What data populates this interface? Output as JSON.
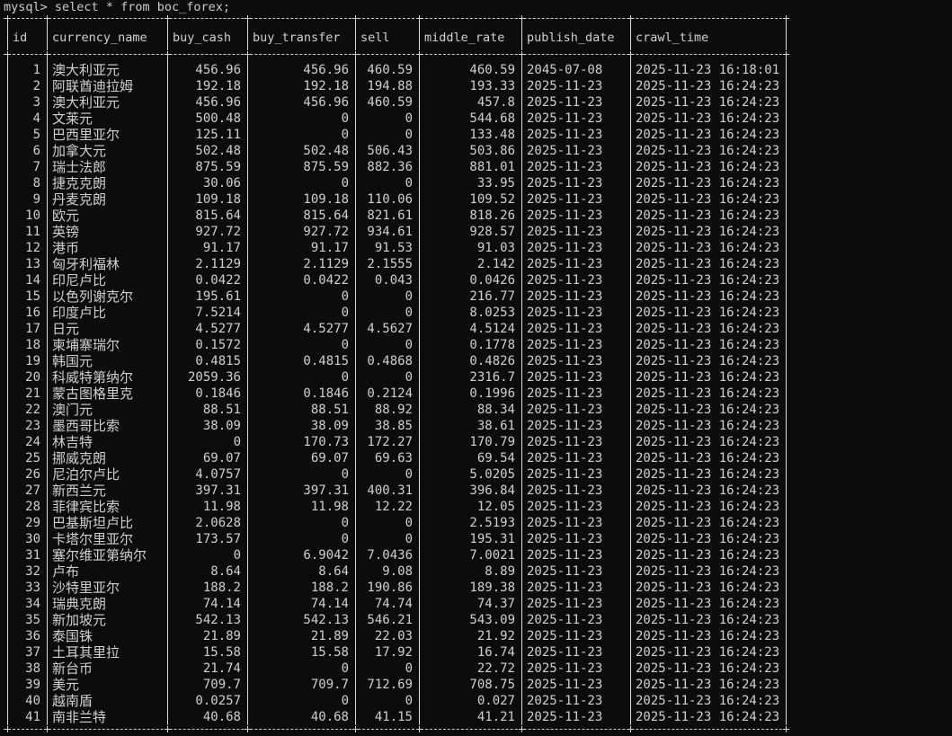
{
  "console": {
    "prompt": "mysql>",
    "command": "select * from boc_forex;"
  },
  "table": {
    "columns": [
      "id",
      "currency_name",
      "buy_cash",
      "buy_transfer",
      "sell",
      "middle_rate",
      "publish_date",
      "crawl_time"
    ],
    "rows": [
      [
        "1",
        "澳大利亚元",
        "456.96",
        "456.96",
        "460.59",
        "460.59",
        "2045-07-08",
        "2025-11-23 16:18:01"
      ],
      [
        "2",
        "阿联酋迪拉姆",
        "192.18",
        "192.18",
        "194.88",
        "193.33",
        "2025-11-23",
        "2025-11-23 16:24:23"
      ],
      [
        "3",
        "澳大利亚元",
        "456.96",
        "456.96",
        "460.59",
        "457.8",
        "2025-11-23",
        "2025-11-23 16:24:23"
      ],
      [
        "4",
        "文莱元",
        "500.48",
        "0",
        "0",
        "544.68",
        "2025-11-23",
        "2025-11-23 16:24:23"
      ],
      [
        "5",
        "巴西里亚尔",
        "125.11",
        "0",
        "0",
        "133.48",
        "2025-11-23",
        "2025-11-23 16:24:23"
      ],
      [
        "6",
        "加拿大元",
        "502.48",
        "502.48",
        "506.43",
        "503.86",
        "2025-11-23",
        "2025-11-23 16:24:23"
      ],
      [
        "7",
        "瑞士法郎",
        "875.59",
        "875.59",
        "882.36",
        "881.01",
        "2025-11-23",
        "2025-11-23 16:24:23"
      ],
      [
        "8",
        "捷克克朗",
        "30.06",
        "0",
        "0",
        "33.95",
        "2025-11-23",
        "2025-11-23 16:24:23"
      ],
      [
        "9",
        "丹麦克朗",
        "109.18",
        "109.18",
        "110.06",
        "109.52",
        "2025-11-23",
        "2025-11-23 16:24:23"
      ],
      [
        "10",
        "欧元",
        "815.64",
        "815.64",
        "821.61",
        "818.26",
        "2025-11-23",
        "2025-11-23 16:24:23"
      ],
      [
        "11",
        "英镑",
        "927.72",
        "927.72",
        "934.61",
        "928.57",
        "2025-11-23",
        "2025-11-23 16:24:23"
      ],
      [
        "12",
        "港币",
        "91.17",
        "91.17",
        "91.53",
        "91.03",
        "2025-11-23",
        "2025-11-23 16:24:23"
      ],
      [
        "13",
        "匈牙利福林",
        "2.1129",
        "2.1129",
        "2.1555",
        "2.142",
        "2025-11-23",
        "2025-11-23 16:24:23"
      ],
      [
        "14",
        "印尼卢比",
        "0.0422",
        "0.0422",
        "0.043",
        "0.0426",
        "2025-11-23",
        "2025-11-23 16:24:23"
      ],
      [
        "15",
        "以色列谢克尔",
        "195.61",
        "0",
        "0",
        "216.77",
        "2025-11-23",
        "2025-11-23 16:24:23"
      ],
      [
        "16",
        "印度卢比",
        "7.5214",
        "0",
        "0",
        "8.0253",
        "2025-11-23",
        "2025-11-23 16:24:23"
      ],
      [
        "17",
        "日元",
        "4.5277",
        "4.5277",
        "4.5627",
        "4.5124",
        "2025-11-23",
        "2025-11-23 16:24:23"
      ],
      [
        "18",
        "柬埔寨瑞尔",
        "0.1572",
        "0",
        "0",
        "0.1778",
        "2025-11-23",
        "2025-11-23 16:24:23"
      ],
      [
        "19",
        "韩国元",
        "0.4815",
        "0.4815",
        "0.4868",
        "0.4826",
        "2025-11-23",
        "2025-11-23 16:24:23"
      ],
      [
        "20",
        "科威特第纳尔",
        "2059.36",
        "0",
        "0",
        "2316.7",
        "2025-11-23",
        "2025-11-23 16:24:23"
      ],
      [
        "21",
        "蒙古图格里克",
        "0.1846",
        "0.1846",
        "0.2124",
        "0.1996",
        "2025-11-23",
        "2025-11-23 16:24:23"
      ],
      [
        "22",
        "澳门元",
        "88.51",
        "88.51",
        "88.92",
        "88.34",
        "2025-11-23",
        "2025-11-23 16:24:23"
      ],
      [
        "23",
        "墨西哥比索",
        "38.09",
        "38.09",
        "38.85",
        "38.61",
        "2025-11-23",
        "2025-11-23 16:24:23"
      ],
      [
        "24",
        "林吉特",
        "0",
        "170.73",
        "172.27",
        "170.79",
        "2025-11-23",
        "2025-11-23 16:24:23"
      ],
      [
        "25",
        "挪威克朗",
        "69.07",
        "69.07",
        "69.63",
        "69.54",
        "2025-11-23",
        "2025-11-23 16:24:23"
      ],
      [
        "26",
        "尼泊尔卢比",
        "4.0757",
        "0",
        "0",
        "5.0205",
        "2025-11-23",
        "2025-11-23 16:24:23"
      ],
      [
        "27",
        "新西兰元",
        "397.31",
        "397.31",
        "400.31",
        "396.84",
        "2025-11-23",
        "2025-11-23 16:24:23"
      ],
      [
        "28",
        "菲律宾比索",
        "11.98",
        "11.98",
        "12.22",
        "12.05",
        "2025-11-23",
        "2025-11-23 16:24:23"
      ],
      [
        "29",
        "巴基斯坦卢比",
        "2.0628",
        "0",
        "0",
        "2.5193",
        "2025-11-23",
        "2025-11-23 16:24:23"
      ],
      [
        "30",
        "卡塔尔里亚尔",
        "173.57",
        "0",
        "0",
        "195.31",
        "2025-11-23",
        "2025-11-23 16:24:23"
      ],
      [
        "31",
        "塞尔维亚第纳尔",
        "0",
        "6.9042",
        "7.0436",
        "7.0021",
        "2025-11-23",
        "2025-11-23 16:24:23"
      ],
      [
        "32",
        "卢布",
        "8.64",
        "8.64",
        "9.08",
        "8.89",
        "2025-11-23",
        "2025-11-23 16:24:23"
      ],
      [
        "33",
        "沙特里亚尔",
        "188.2",
        "188.2",
        "190.86",
        "189.38",
        "2025-11-23",
        "2025-11-23 16:24:23"
      ],
      [
        "34",
        "瑞典克朗",
        "74.14",
        "74.14",
        "74.74",
        "74.37",
        "2025-11-23",
        "2025-11-23 16:24:23"
      ],
      [
        "35",
        "新加坡元",
        "542.13",
        "542.13",
        "546.21",
        "543.09",
        "2025-11-23",
        "2025-11-23 16:24:23"
      ],
      [
        "36",
        "泰国铢",
        "21.89",
        "21.89",
        "22.03",
        "21.92",
        "2025-11-23",
        "2025-11-23 16:24:23"
      ],
      [
        "37",
        "土耳其里拉",
        "15.58",
        "15.58",
        "17.92",
        "16.74",
        "2025-11-23",
        "2025-11-23 16:24:23"
      ],
      [
        "38",
        "新台币",
        "21.74",
        "0",
        "0",
        "22.72",
        "2025-11-23",
        "2025-11-23 16:24:23"
      ],
      [
        "39",
        "美元",
        "709.7",
        "709.7",
        "712.69",
        "708.75",
        "2025-11-23",
        "2025-11-23 16:24:23"
      ],
      [
        "40",
        "越南盾",
        "0.0257",
        "0",
        "0",
        "0.027",
        "2025-11-23",
        "2025-11-23 16:24:23"
      ],
      [
        "41",
        "南非兰特",
        "40.68",
        "40.68",
        "41.15",
        "41.21",
        "2025-11-23",
        "2025-11-23 16:24:23"
      ]
    ]
  },
  "colors": {
    "background": "#0c0c0c",
    "text": "#cccccc"
  }
}
